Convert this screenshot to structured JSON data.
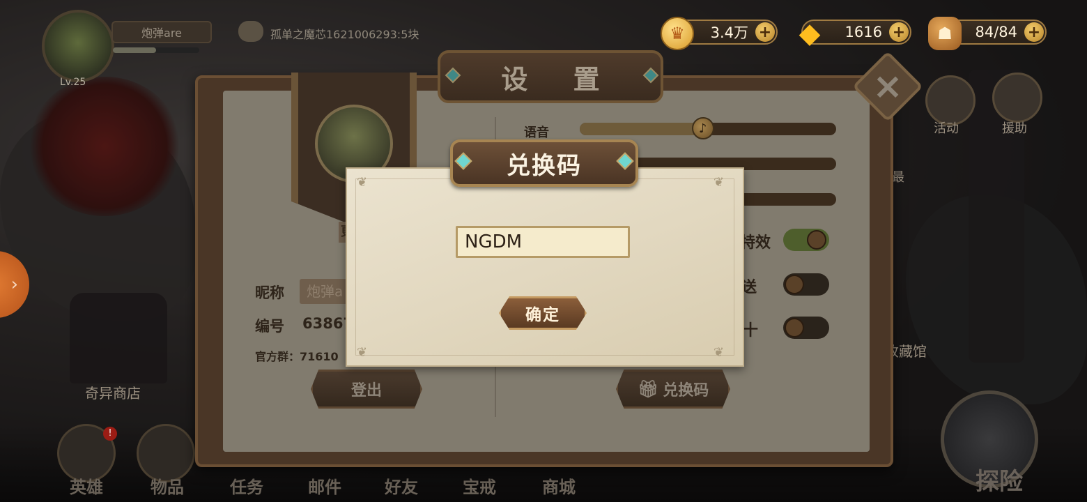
{
  "player": {
    "level": "Lv.25",
    "name": "炮弹are",
    "chat_ticker": "孤单之魔芯1621006293:5块"
  },
  "resources": [
    {
      "icon": "gold-coin-icon",
      "value": "3.4万"
    },
    {
      "icon": "diamond-icon",
      "value": "1616"
    },
    {
      "icon": "stamina-bread-icon",
      "value": "84/84"
    }
  ],
  "side_menu": {
    "activity": "活动",
    "support": "援助",
    "partial_item": "最",
    "collection": "收藏馆"
  },
  "left_scene": {
    "strange_shop": "奇异商店"
  },
  "bottom_nav": {
    "items": [
      "英雄",
      "物品",
      "任务",
      "邮件",
      "好友",
      "宝戒",
      "商城"
    ],
    "badge": "!",
    "explore": "探险"
  },
  "settings": {
    "title": "设 置",
    "voice_label": "语音",
    "nickname_label": "昵称",
    "nickname_value": "炮弹a",
    "id_label": "编号",
    "id_value": "63867",
    "official_group": "官方群：71610",
    "logout": "登出",
    "redeem_button": "兑换码",
    "toggle_1_label": "特效",
    "toggle_2_label": "送",
    "toggle_3_label": "十",
    "partial_avatar_label": "更",
    "voice_level": 0.48,
    "toggles": {
      "effects": true,
      "second": false,
      "third": false
    }
  },
  "redeem_dialog": {
    "title": "兑换码",
    "code_value": "NGDM",
    "confirm": "确定"
  },
  "colors": {
    "gold_accent": "#c49a61",
    "paper": "#e8dfca",
    "frame_wood": "#4a3626",
    "toggle_on": "#4e5e2c",
    "left_tab_orange": "#d66a28"
  }
}
